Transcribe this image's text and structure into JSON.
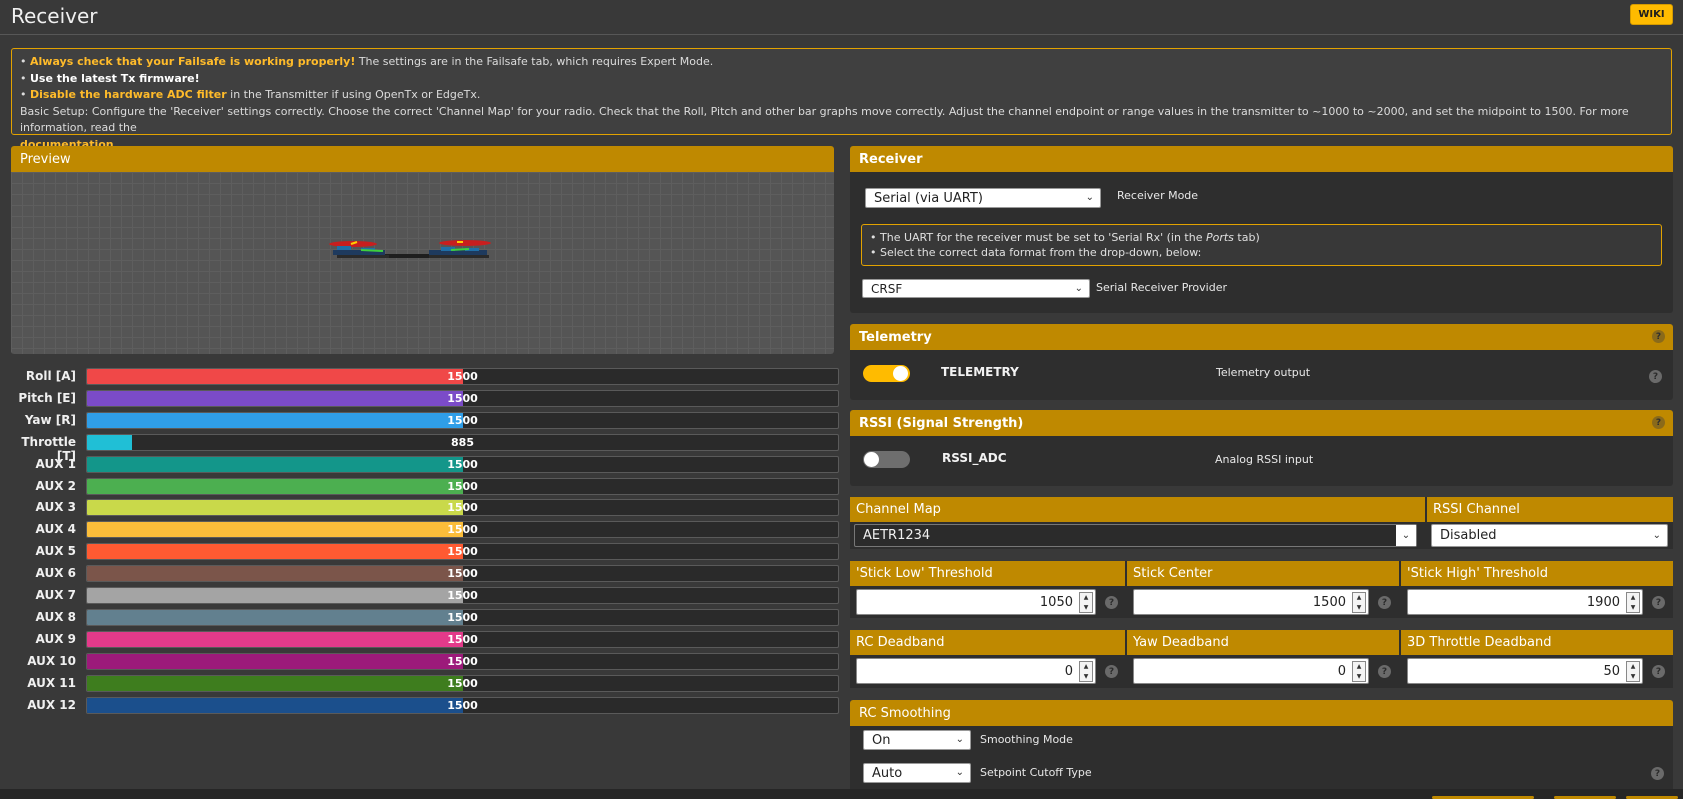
{
  "page": {
    "title": "Receiver",
    "wiki_label": "WIKI"
  },
  "notice": {
    "line1_highlight": "Always check that your Failsafe is working properly!",
    "line1_rest": " The settings are in the Failsafe tab, which requires Expert Mode.",
    "line2_bold": "Use the latest Tx firmware!",
    "line3_highlight": "Disable the hardware ADC filter",
    "line3_rest": " in the Transmitter if using OpenTx or EdgeTx.",
    "line4": "Basic Setup: Configure the 'Receiver' settings correctly. Choose the correct 'Channel Map' for your radio. Check that the Roll, Pitch and other bar graphs move correctly. Adjust the channel endpoint or range values in the transmitter to ~1000 to ~2000, and set the midpoint to 1500. For more information, read the",
    "line5_link": "documentation",
    "line5_end": "."
  },
  "preview": {
    "title": "Preview"
  },
  "channels": [
    {
      "label": "Roll [A]",
      "value": "1500",
      "fill": 0.5,
      "color": "#f04848"
    },
    {
      "label": "Pitch [E]",
      "value": "1500",
      "fill": 0.5,
      "color": "#7b4bc8"
    },
    {
      "label": "Yaw [R]",
      "value": "1500",
      "fill": 0.5,
      "color": "#2f9ee8"
    },
    {
      "label": "Throttle [T]",
      "value": "885",
      "fill": 0.06,
      "color": "#20bfd6"
    },
    {
      "label": "AUX 1",
      "value": "1500",
      "fill": 0.5,
      "color": "#13968a"
    },
    {
      "label": "AUX 2",
      "value": "1500",
      "fill": 0.5,
      "color": "#4caf50"
    },
    {
      "label": "AUX 3",
      "value": "1500",
      "fill": 0.5,
      "color": "#c9d94a"
    },
    {
      "label": "AUX 4",
      "value": "1500",
      "fill": 0.5,
      "color": "#fbbd3a"
    },
    {
      "label": "AUX 5",
      "value": "1500",
      "fill": 0.5,
      "color": "#ff5a32"
    },
    {
      "label": "AUX 6",
      "value": "1500",
      "fill": 0.5,
      "color": "#7b554a"
    },
    {
      "label": "AUX 7",
      "value": "1500",
      "fill": 0.5,
      "color": "#a4a4a4"
    },
    {
      "label": "AUX 8",
      "value": "1500",
      "fill": 0.5,
      "color": "#62808f"
    },
    {
      "label": "AUX 9",
      "value": "1500",
      "fill": 0.5,
      "color": "#e33a8a"
    },
    {
      "label": "AUX 10",
      "value": "1500",
      "fill": 0.5,
      "color": "#9c1a7a"
    },
    {
      "label": "AUX 11",
      "value": "1500",
      "fill": 0.5,
      "color": "#3e7d1e"
    },
    {
      "label": "AUX 12",
      "value": "1500",
      "fill": 0.5,
      "color": "#1b4f8c"
    }
  ],
  "receiver": {
    "title": "Receiver",
    "mode_value": "Serial (via UART)",
    "mode_label": "Receiver Mode",
    "note_line1_pre": "The UART for the receiver must be set to 'Serial Rx' (in the ",
    "note_line1_em": "Ports",
    "note_line1_post": " tab)",
    "note_line2": "Select the correct data format from the drop-down, below:",
    "provider_value": "CRSF",
    "provider_label": "Serial Receiver Provider"
  },
  "telemetry": {
    "title": "Telemetry",
    "toggle_name": "TELEMETRY",
    "toggle_desc": "Telemetry output",
    "enabled": true
  },
  "rssi": {
    "title": "RSSI (Signal Strength)",
    "toggle_name": "RSSI_ADC",
    "toggle_desc": "Analog RSSI input",
    "enabled": false
  },
  "channel_map": {
    "map_title": "Channel Map",
    "map_value": "AETR1234",
    "rssi_channel_title": "RSSI Channel",
    "rssi_channel_value": "Disabled"
  },
  "thresholds": {
    "low_title": "'Stick Low' Threshold",
    "low_value": "1050",
    "center_title": "Stick Center",
    "center_value": "1500",
    "high_title": "'Stick High' Threshold",
    "high_value": "1900"
  },
  "deadbands": {
    "rc_title": "RC Deadband",
    "rc_value": "0",
    "yaw_title": "Yaw Deadband",
    "yaw_value": "0",
    "throttle3d_title": "3D Throttle Deadband",
    "throttle3d_value": "50"
  },
  "smoothing": {
    "title": "RC Smoothing",
    "mode_value": "On",
    "mode_label": "Smoothing Mode",
    "cutoff_value": "Auto",
    "cutoff_label": "Setpoint Cutoff Type"
  },
  "icons": {
    "help": "?",
    "chevron": "⌄"
  },
  "colors": {
    "accent": "#bf8900",
    "toggle_on": "#ffbb00",
    "toggle_off": "#6e6e6e"
  }
}
